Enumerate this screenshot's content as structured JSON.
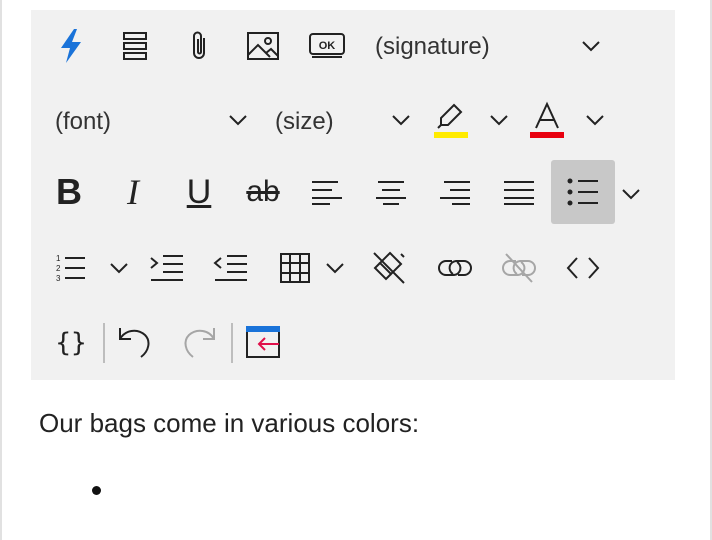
{
  "toolbar": {
    "signature_label": "(signature)",
    "font_label": "(font)",
    "size_label": "(size)",
    "bold_label": "B",
    "italic_label": "I",
    "underline_label": "U",
    "strike_label": "ab",
    "highlight_color": "#ffeb00",
    "font_color": "#e8000f",
    "accent_color": "#1a73d9",
    "disabled_color": "#a6a6a6"
  },
  "body": {
    "text": "Our bags come in various colors:",
    "list_items": [
      ""
    ]
  }
}
